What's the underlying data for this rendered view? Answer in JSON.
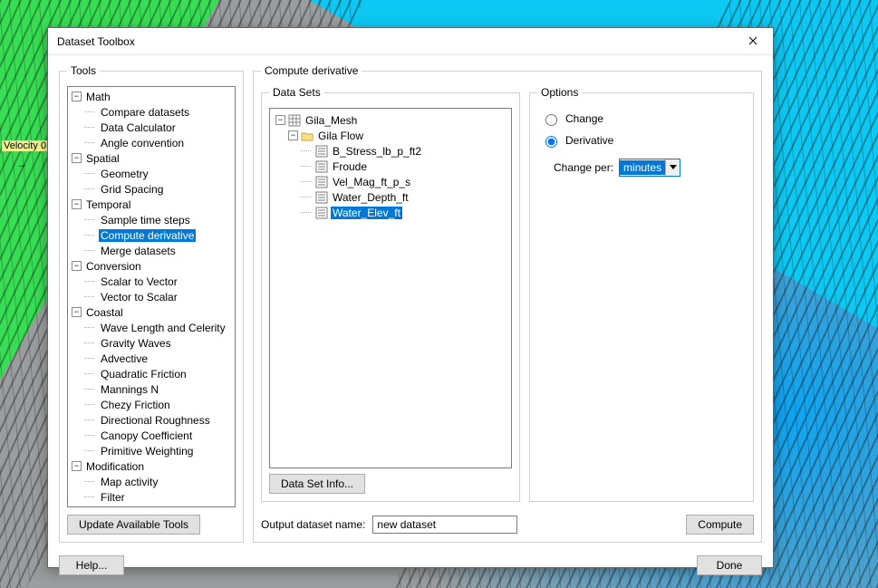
{
  "bg": {
    "axis_label": "Velocity 0"
  },
  "window": {
    "title": "Dataset Toolbox"
  },
  "tools_group": {
    "legend": "Tools",
    "update_btn": "Update Available Tools"
  },
  "tree": {
    "math": {
      "label": "Math",
      "items": [
        "Compare datasets",
        "Data Calculator",
        "Angle convention"
      ]
    },
    "spatial": {
      "label": "Spatial",
      "items": [
        "Geometry",
        "Grid Spacing"
      ]
    },
    "temporal": {
      "label": "Temporal",
      "items": [
        "Sample time steps",
        "Compute derivative",
        "Merge datasets"
      ],
      "selected_index": 1
    },
    "conversion": {
      "label": "Conversion",
      "items": [
        "Scalar to Vector",
        "Vector to Scalar"
      ]
    },
    "coastal": {
      "label": "Coastal",
      "items": [
        "Wave Length and Celerity",
        "Gravity Waves",
        "Advective",
        "Quadratic Friction",
        "Mannings N",
        "Chezy Friction",
        "Directional Roughness",
        "Canopy Coefficient",
        "Primitive Weighting"
      ]
    },
    "modification": {
      "label": "Modification",
      "items": [
        "Map activity",
        "Filter"
      ]
    }
  },
  "compute_group": {
    "legend": "Compute derivative"
  },
  "datasets_group": {
    "legend": "Data Sets",
    "info_btn": "Data Set Info...",
    "root": "Gila_Mesh",
    "folder": "Gila Flow",
    "items": [
      "B_Stress_lb_p_ft2",
      "Froude",
      "Vel_Mag_ft_p_s",
      "Water_Depth_ft",
      "Water_Elev_ft"
    ],
    "selected_index": 4
  },
  "options_group": {
    "legend": "Options",
    "change_label": "Change",
    "derivative_label": "Derivative",
    "change_per_label": "Change per:",
    "change_per_value": "minutes",
    "selected": "derivative"
  },
  "output": {
    "label": "Output dataset name:",
    "value": "new dataset"
  },
  "buttons": {
    "compute": "Compute",
    "help": "Help...",
    "done": "Done"
  }
}
